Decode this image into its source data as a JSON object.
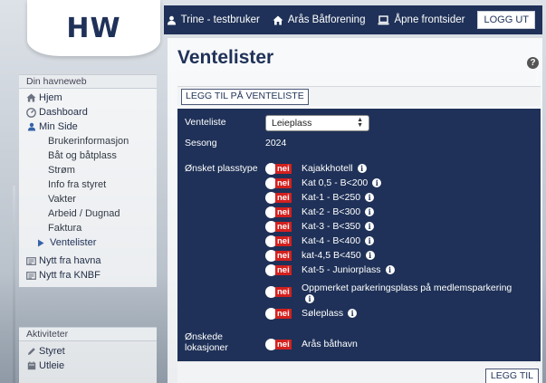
{
  "logo": "HW",
  "topbar": {
    "user": "Trine - testbruker",
    "club": "Arås Båtforening",
    "frontpages": "Åpne frontsider",
    "logout": "LOGG UT"
  },
  "sidebar": {
    "section1": "Din havneweb",
    "items": [
      {
        "label": "Hjem",
        "icon": "home-icon"
      },
      {
        "label": "Dashboard",
        "icon": "dashboard-icon"
      },
      {
        "label": "Min Side",
        "icon": "user-icon"
      },
      {
        "label": "Brukerinformasjon"
      },
      {
        "label": "Båt og båtplass"
      },
      {
        "label": "Strøm"
      },
      {
        "label": "Info fra styret"
      },
      {
        "label": "Vakter"
      },
      {
        "label": "Arbeid / Dugnad"
      },
      {
        "label": "Faktura"
      },
      {
        "label": "Ventelister",
        "icon": "arrow-right-icon"
      },
      {
        "label": "Nytt fra havna",
        "icon": "newspaper-icon"
      },
      {
        "label": "Nytt fra KNBF",
        "icon": "newspaper-icon"
      }
    ],
    "section2": "Aktiviteter",
    "activities": [
      {
        "label": "Styret",
        "icon": "pencil-icon"
      },
      {
        "label": "Utleie",
        "icon": "calendar-icon"
      }
    ]
  },
  "main": {
    "title": "Ventelister",
    "add_button": "LEGG TIL PÅ VENTELISTE",
    "form": {
      "venteliste_label": "Venteliste",
      "venteliste_value": "Leieplass",
      "sesong_label": "Sesong",
      "sesong_value": "2024",
      "plasstype_label": "Ønsket plasstype",
      "plasstyper": [
        {
          "label": "Kajakkhotell",
          "toggle": "nei"
        },
        {
          "label": "Kat 0,5 - B<200",
          "toggle": "nei"
        },
        {
          "label": "Kat-1 - B<250",
          "toggle": "nei"
        },
        {
          "label": "Kat-2 - B<300",
          "toggle": "nei"
        },
        {
          "label": "Kat-3 - B<350",
          "toggle": "nei"
        },
        {
          "label": "Kat-4 - B<400",
          "toggle": "nei"
        },
        {
          "label": "kat-4,5 B<450",
          "toggle": "nei"
        },
        {
          "label": "Kat-5 - Juniorplass",
          "toggle": "nei"
        },
        {
          "label": "Oppmerket parkeringsplass på medlemsparkering",
          "toggle": "nei"
        },
        {
          "label": "Søleplass",
          "toggle": "nei"
        }
      ],
      "lokasjoner_label_1": "Ønskede",
      "lokasjoner_label_2": "lokasjoner",
      "lokasjon": {
        "label": "Arås båthavn",
        "toggle": "nei"
      }
    },
    "legg_til": "LEGG TIL"
  },
  "colors": {
    "navy": "#1f3158",
    "toggle_off": "#d3211f"
  }
}
